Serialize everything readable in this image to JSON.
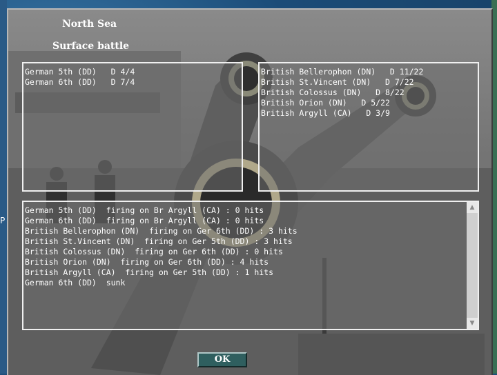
{
  "dialog": {
    "region": "North Sea",
    "battle_type": "Surface battle",
    "german_ships": [
      "German 5th (DD)   D 4/4",
      "German 6th (DD)   D 7/4"
    ],
    "british_ships": [
      "British Bellerophon (DN)   D 11/22",
      "British St.Vincent (DN)   D 7/22",
      "British Colossus (DN)   D 8/22",
      "British Orion (DN)   D 5/22",
      "British Argyll (CA)   D 3/9"
    ],
    "combat_log": [
      "German 5th (DD)  firing on Br Argyll (CA) : 0 hits",
      "German 6th (DD)  firing on Br Argyll (CA) : 0 hits",
      "British Bellerophon (DN)  firing on Ger 6th (DD) : 3 hits",
      "British St.Vincent (DN)  firing on Ger 5th (DD) : 3 hits",
      "British Colossus (DN)  firing on Ger 6th (DD) : 0 hits",
      "British Orion (DN)  firing on Ger 6th (DD) : 4 hits",
      "British Argyll (CA)  firing on Ger 5th (DD) : 1 hits",
      "German 6th (DD)  sunk"
    ],
    "ok_label": "OK"
  },
  "background": {
    "edge_text": "P"
  },
  "colors": {
    "dialog_bg": "#7b7b7b",
    "panel_border": "#f0f0f0",
    "ok_button": "#2f5f5f",
    "text": "#ffffff"
  }
}
